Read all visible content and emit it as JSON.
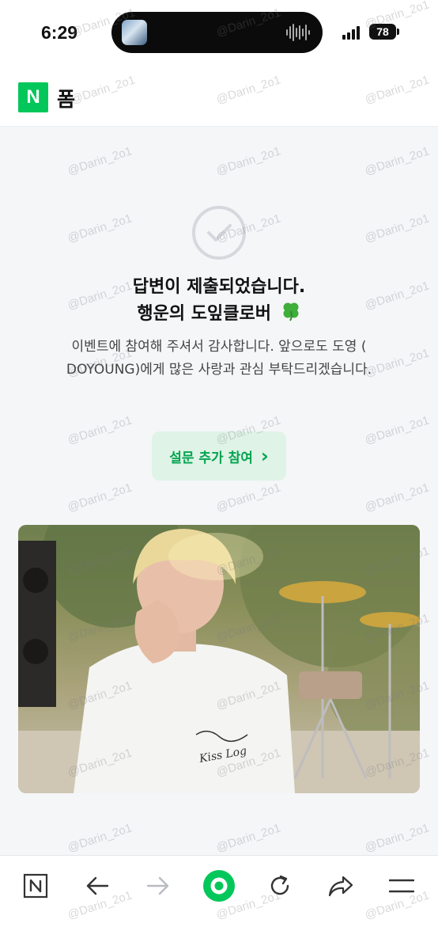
{
  "status_bar": {
    "time": "6:29",
    "battery": "78"
  },
  "header": {
    "logo_letter": "N",
    "title": "폼"
  },
  "result": {
    "headline_line1": "답변이 제출되었습니다.",
    "headline_line2": "행운의 도잎클로버",
    "message": "이벤트에 참여해 주셔서 감사합니다. 앞으로도 도영 ( DOYOUNG)에게 많은 사랑과 관심 부탁드리겠습니다.",
    "survey_button_label": "설문 추가 참여",
    "survey_button_arrow": "›"
  },
  "photo": {
    "shirt_text": "Kiss Log"
  },
  "watermark": {
    "text": "@Darin_2o1"
  },
  "toolbar": {
    "items": [
      {
        "icon": "naver-n-icon",
        "label": "N"
      },
      {
        "icon": "back-arrow-icon"
      },
      {
        "icon": "forward-arrow-icon"
      },
      {
        "icon": "green-dot-icon"
      },
      {
        "icon": "refresh-icon"
      },
      {
        "icon": "share-icon"
      },
      {
        "icon": "menu-icon"
      }
    ]
  },
  "colors": {
    "brand_green": "#03c75a",
    "button_text_green": "#04a550",
    "button_bg": "#dff3e7",
    "page_bg": "#f5f6f8"
  }
}
